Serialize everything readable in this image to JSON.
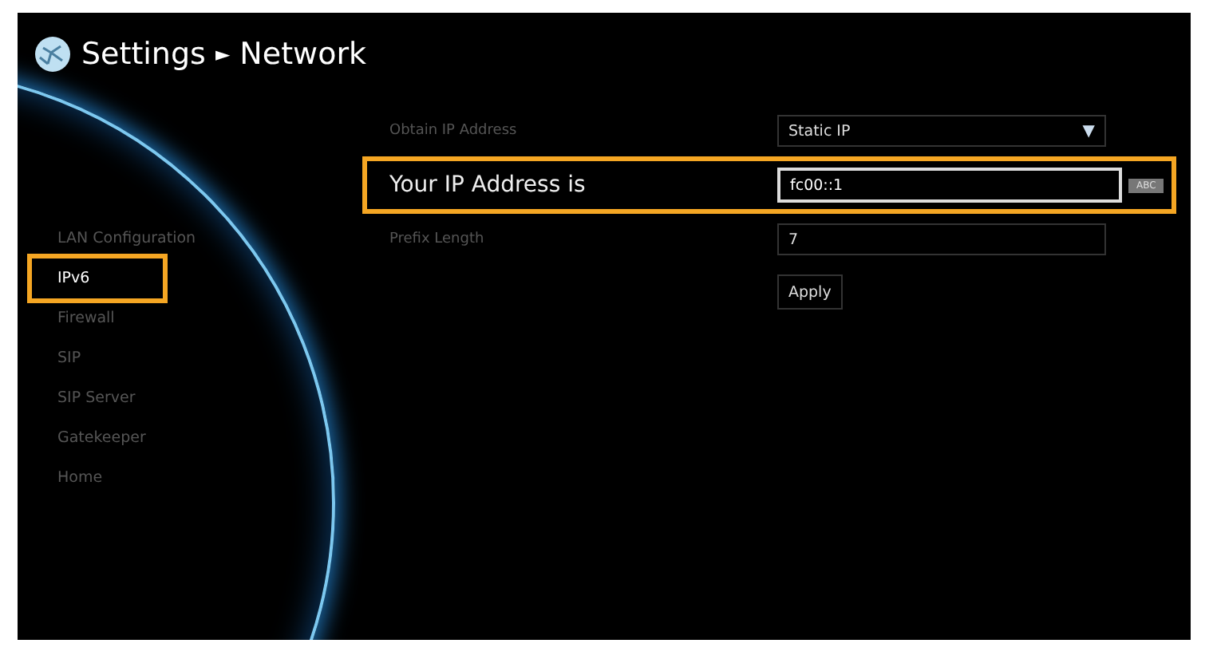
{
  "header": {
    "breadcrumb": [
      "Settings",
      "►",
      "Network"
    ]
  },
  "sidebar": {
    "items": [
      {
        "label": "LAN Configuration",
        "selected": false,
        "highlighted": false
      },
      {
        "label": "IPv6",
        "selected": true,
        "highlighted": true
      },
      {
        "label": "Firewall",
        "selected": false,
        "highlighted": false
      },
      {
        "label": "SIP",
        "selected": false,
        "highlighted": false
      },
      {
        "label": "SIP Server",
        "selected": false,
        "highlighted": false
      },
      {
        "label": "Gatekeeper",
        "selected": false,
        "highlighted": false
      },
      {
        "label": "Home",
        "selected": false,
        "highlighted": false
      }
    ]
  },
  "form": {
    "rows": [
      {
        "kind": "dropdown",
        "label": "Obtain IP Address",
        "value": "Static IP",
        "caret": "▼",
        "focused": false,
        "highlighted": false
      },
      {
        "kind": "text",
        "label": "Your IP Address is",
        "value": "fc00::1",
        "badge": "ABC",
        "focused": true,
        "highlighted": true
      },
      {
        "kind": "text",
        "label": "Prefix Length",
        "value": "7",
        "focused": false,
        "highlighted": false
      },
      {
        "kind": "button",
        "label": "Apply",
        "focused": false,
        "highlighted": false
      }
    ]
  }
}
